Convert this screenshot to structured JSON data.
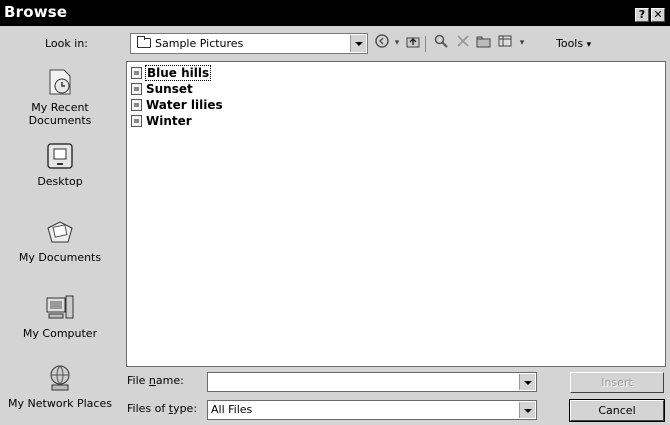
{
  "window": {
    "title": "Browse"
  },
  "titlebar": {
    "help_glyph": "?",
    "close_glyph": "✕"
  },
  "lookin": {
    "label": "Look in:",
    "value": "Sample Pictures"
  },
  "toolbar": {
    "icons": [
      "back-icon",
      "up-folder-icon",
      "search-web-icon",
      "delete-icon",
      "new-folder-icon",
      "views-icon"
    ],
    "tools_label": "Tools"
  },
  "places": [
    {
      "label": "My Recent Documents",
      "icon": "recent-documents-icon"
    },
    {
      "label": "Desktop",
      "icon": "desktop-icon"
    },
    {
      "label": "My Documents",
      "icon": "my-documents-icon"
    },
    {
      "label": "My Computer",
      "icon": "my-computer-icon"
    },
    {
      "label": "My Network Places",
      "icon": "network-places-icon"
    }
  ],
  "files": [
    {
      "name": "Blue hills",
      "selected": true
    },
    {
      "name": "Sunset",
      "selected": false
    },
    {
      "name": "Water lilies",
      "selected": false
    },
    {
      "name": "Winter",
      "selected": false
    }
  ],
  "filename": {
    "label_pre": "File ",
    "label_u": "n",
    "label_post": "ame:",
    "value": ""
  },
  "filetype": {
    "label_pre": "Files of ",
    "label_u": "t",
    "label_post": "ype:",
    "value": "All Files"
  },
  "buttons": {
    "insert": "Insert",
    "cancel": "Cancel"
  }
}
